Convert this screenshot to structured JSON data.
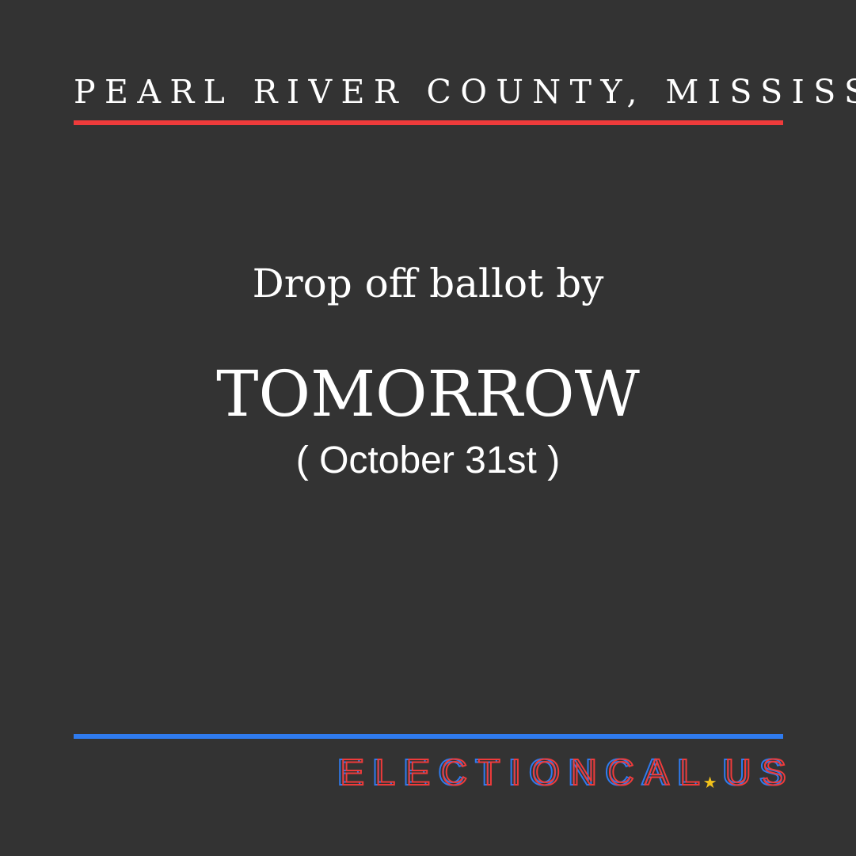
{
  "header": {
    "region": "PEARL RIVER COUNTY, MISSISSIPPI"
  },
  "message": {
    "caption": "Drop off ballot by",
    "headline": "TOMORROW",
    "date": "( October 31st )"
  },
  "brand": {
    "name_part1": "ELECTIONCAL",
    "name_part2": "US",
    "star_glyph": "★",
    "star_icon": "star-icon"
  },
  "colors": {
    "background": "#333333",
    "accent_red": "#ef3b3b",
    "accent_blue": "#2f7bef",
    "star_gold": "#f2c21b",
    "text": "#ffffff"
  }
}
